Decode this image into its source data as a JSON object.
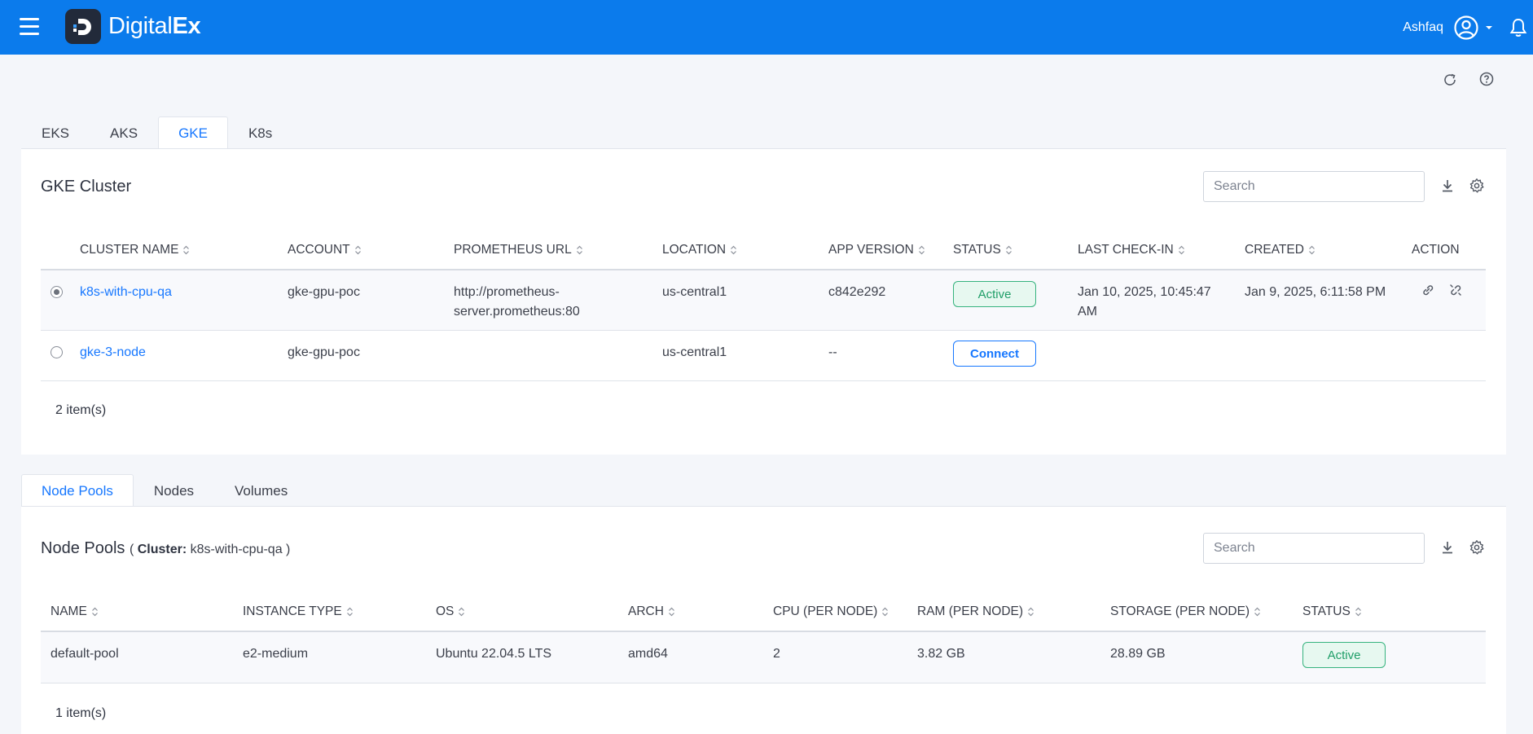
{
  "brand": {
    "name_light": "Digital",
    "name_bold": "Ex"
  },
  "user": {
    "name": "Ashfaq"
  },
  "cluster_tabs": [
    "EKS",
    "AKS",
    "GKE",
    "K8s"
  ],
  "cluster_panel": {
    "title": "GKE Cluster",
    "search_placeholder": "Search",
    "columns": [
      "CLUSTER NAME",
      "ACCOUNT",
      "PROMETHEUS URL",
      "LOCATION",
      "APP VERSION",
      "STATUS",
      "LAST CHECK-IN",
      "CREATED",
      "ACTION"
    ],
    "rows": [
      {
        "name": "k8s-with-cpu-qa",
        "account": "gke-gpu-poc",
        "prometheus_line1": "http://prometheus-",
        "prometheus_line2": "server.prometheus:80",
        "location": "us-central1",
        "app_version": "c842e292",
        "status": "Active",
        "last_checkin_line1": "Jan 10, 2025, 10:45:47",
        "last_checkin_line2": "AM",
        "created": "Jan 9, 2025, 6:11:58 PM"
      },
      {
        "name": "gke-3-node",
        "account": "gke-gpu-poc",
        "location": "us-central1",
        "app_version": "--",
        "status": "Connect"
      }
    ],
    "count": "2 item(s)"
  },
  "detail_tabs": [
    "Node Pools",
    "Nodes",
    "Volumes"
  ],
  "node_panel": {
    "title": "Node Pools",
    "cluster_prefix": "(",
    "cluster_label": "Cluster:",
    "cluster_value": "k8s-with-cpu-qa",
    "cluster_suffix": ")",
    "search_placeholder": "Search",
    "columns": [
      "NAME",
      "INSTANCE TYPE",
      "OS",
      "ARCH",
      "CPU (PER NODE)",
      "RAM (PER NODE)",
      "STORAGE (PER NODE)",
      "STATUS"
    ],
    "rows": [
      {
        "name": "default-pool",
        "instance_type": "e2-medium",
        "os": "Ubuntu 22.04.5 LTS",
        "arch": "amd64",
        "cpu": "2",
        "ram": "3.82 GB",
        "storage": "28.89 GB",
        "status": "Active"
      }
    ],
    "count": "1 item(s)"
  },
  "colors": {
    "primary": "#0b7bec",
    "link": "#1677ff",
    "success": "#36b37e"
  }
}
